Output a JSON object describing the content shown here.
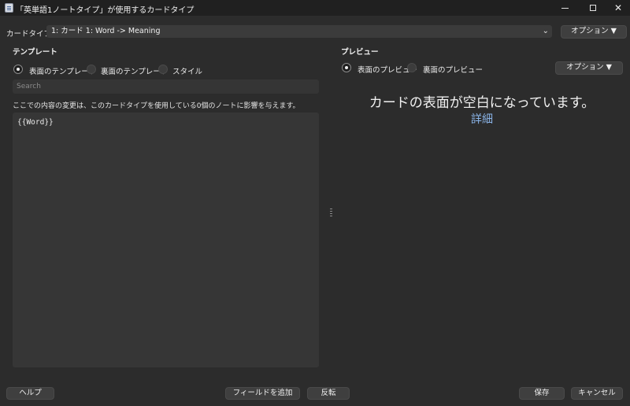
{
  "window": {
    "title": "「英単語1ノートタイプ」が使用するカードタイプ",
    "icons": {
      "app": "anki-app-icon",
      "minimize": "minimize-icon",
      "maximize": "maximize-icon",
      "close": "close-icon"
    }
  },
  "card_type": {
    "label": "カードタイプ:",
    "selected": "1: カード 1: Word -> Meaning",
    "options_button": "オプション ▼"
  },
  "template": {
    "title": "テンプレート",
    "tabs": [
      {
        "label": "表面のテンプレート",
        "selected": true
      },
      {
        "label": "裏面のテンプレート",
        "selected": false
      },
      {
        "label": "スタイル",
        "selected": false
      }
    ],
    "search_placeholder": "Search",
    "info": "ここでの内容の変更は、このカードタイプを使用している0個のノートに影響を与えます。",
    "editor_content": "{{Word}}"
  },
  "preview": {
    "title": "プレビュー",
    "tabs": [
      {
        "label": "表面のプレビュー",
        "selected": true
      },
      {
        "label": "裏面のプレビュー",
        "selected": false
      }
    ],
    "options_button": "オプション ▼",
    "message": "カードの表面が空白になっています。",
    "link": "詳細"
  },
  "footer": {
    "help": "ヘルプ",
    "add_field": "フィールドを追加",
    "flip": "反転",
    "save": "保存",
    "cancel": "キャンセル"
  },
  "colors": {
    "background": "#2c2c2c",
    "titlebar": "#202020",
    "button": "#3f3f3f",
    "link": "#8ab4e8"
  }
}
